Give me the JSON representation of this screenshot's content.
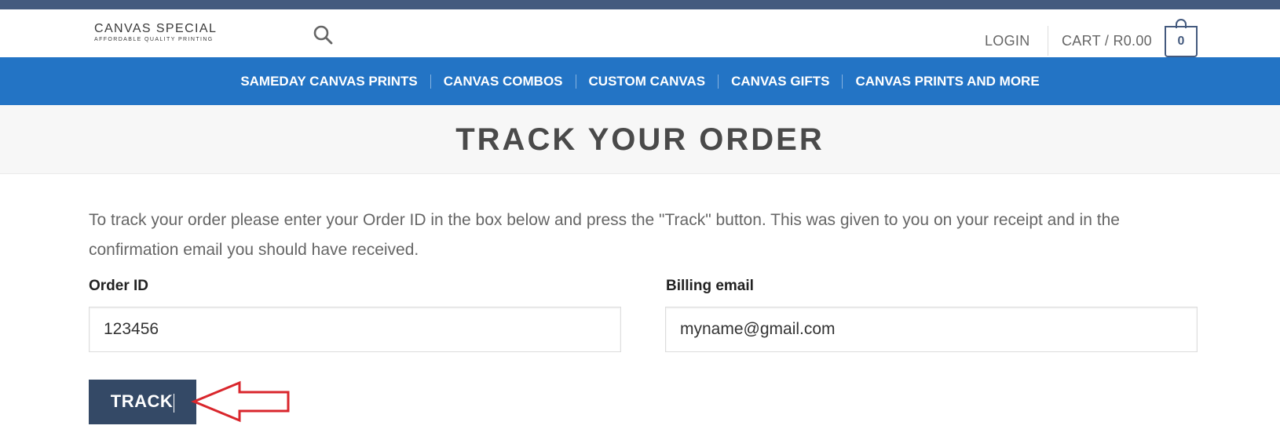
{
  "header": {
    "logo_main": "CANVAS SPECIAL",
    "logo_sub": "AFFORDABLE QUALITY PRINTING",
    "search_icon": "search-icon",
    "login_label": "LOGIN",
    "cart_label": "CART / R0.00",
    "cart_count": "0"
  },
  "nav": {
    "items": [
      {
        "label": "SAMEDAY CANVAS PRINTS"
      },
      {
        "label": "CANVAS COMBOS"
      },
      {
        "label": "CUSTOM CANVAS"
      },
      {
        "label": "CANVAS GIFTS"
      },
      {
        "label": "CANVAS PRINTS AND MORE"
      }
    ]
  },
  "page": {
    "title": "TRACK YOUR ORDER",
    "intro": "To track your order please enter your Order ID in the box below and press the \"Track\" button. This was given to you on your receipt and in the confirmation email you should have received."
  },
  "form": {
    "order_id_label": "Order ID",
    "order_id_value": "123456",
    "email_label": "Billing email",
    "email_value": "myname@gmail.com",
    "track_label": "TRACK"
  },
  "colors": {
    "top_strip": "#445a7e",
    "nav_bg": "#2374c5",
    "button_bg": "#344966",
    "annotation_arrow": "#d9262c"
  }
}
